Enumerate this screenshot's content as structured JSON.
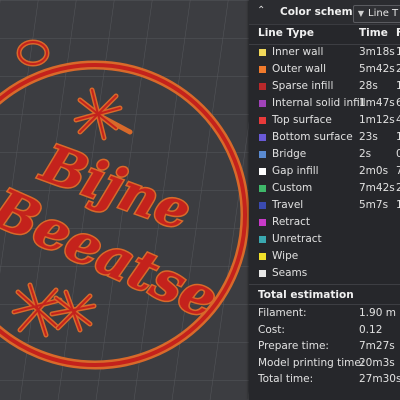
{
  "colors": {
    "viewport_bg": "#3c3d41",
    "panel_bg": "#26272b",
    "model_red": "#c4221c",
    "model_orange": "#d8692a"
  },
  "model": {
    "text_line1": "Bijne",
    "text_line2": "Beeatse"
  },
  "panel": {
    "collapse_icon": "chevron-up-icon",
    "title": "Color scheme",
    "select_value": "Line T",
    "columns": {
      "type": "Line Type",
      "time": "Time",
      "extra": "F"
    },
    "line_types": [
      {
        "label": "Inner wall",
        "time": "3m18s",
        "extra": "1",
        "color": "#f0d85a"
      },
      {
        "label": "Outer wall",
        "time": "5m42s",
        "extra": "2",
        "color": "#f07a2c"
      },
      {
        "label": "Sparse infill",
        "time": "28s",
        "extra": "1",
        "color": "#b8282a"
      },
      {
        "label": "Internal solid infill",
        "time": "1m47s",
        "extra": "6",
        "color": "#a042b8"
      },
      {
        "label": "Top surface",
        "time": "1m12s",
        "extra": "4",
        "color": "#e83a3a"
      },
      {
        "label": "Bottom surface",
        "time": "23s",
        "extra": "1",
        "color": "#6a5ad8"
      },
      {
        "label": "Bridge",
        "time": "2s",
        "extra": "0",
        "color": "#5a8ad0"
      },
      {
        "label": "Gap infill",
        "time": "2m0s",
        "extra": "7",
        "color": "#ffffff"
      },
      {
        "label": "Custom",
        "time": "7m42s",
        "extra": "2",
        "color": "#3fb86a"
      },
      {
        "label": "Travel",
        "time": "5m7s",
        "extra": "1",
        "color": "#3a4ab0"
      },
      {
        "label": "Retract",
        "time": "",
        "extra": "",
        "color": "#c83ac8"
      },
      {
        "label": "Unretract",
        "time": "",
        "extra": "",
        "color": "#3aa8b0"
      },
      {
        "label": "Wipe",
        "time": "",
        "extra": "",
        "color": "#f0e02a"
      },
      {
        "label": "Seams",
        "time": "",
        "extra": "",
        "color": "#e8e8e8"
      }
    ]
  },
  "estimation": {
    "title": "Total estimation",
    "rows": [
      {
        "key": "Filament:",
        "value": "1.90 m"
      },
      {
        "key": "Cost:",
        "value": "0.12"
      },
      {
        "key": "Prepare time:",
        "value": "7m27s"
      },
      {
        "key": "Model printing time:",
        "value": "20m3s"
      },
      {
        "key": "Total time:",
        "value": "27m30s"
      }
    ]
  }
}
